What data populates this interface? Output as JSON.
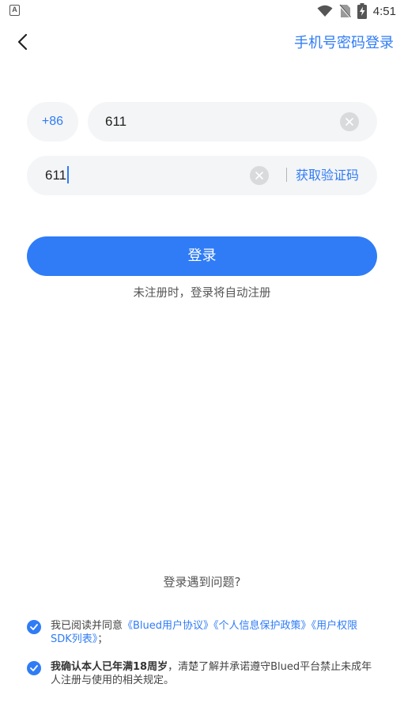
{
  "status_bar": {
    "time": "4:51",
    "app_icon_letter": "A"
  },
  "header": {
    "password_login_label": "手机号密码登录"
  },
  "form": {
    "country_code": "+86",
    "phone_value": "611",
    "code_value": "611",
    "get_code_label": "获取验证码"
  },
  "login_button_label": "登录",
  "register_hint": "未注册时，登录将自动注册",
  "help_link_label": "登录遇到问题?",
  "agreement_1": {
    "prefix": "我已阅读并同意",
    "user_agreement": "《Blued用户协议》",
    "privacy_policy": "《个人信息保护政策》",
    "sdk_list": "《用户权限 SDK列表》",
    "suffix": "；"
  },
  "agreement_2": {
    "bold": "我确认本人已年满18周岁",
    "rest": "，清楚了解并承诺遵守Blued平台禁止未成年人注册与使用的相关规定。"
  },
  "colors": {
    "accent": "#2f7cf6",
    "field_background": "#f4f5f7",
    "clear_icon": "#d9dadc"
  }
}
